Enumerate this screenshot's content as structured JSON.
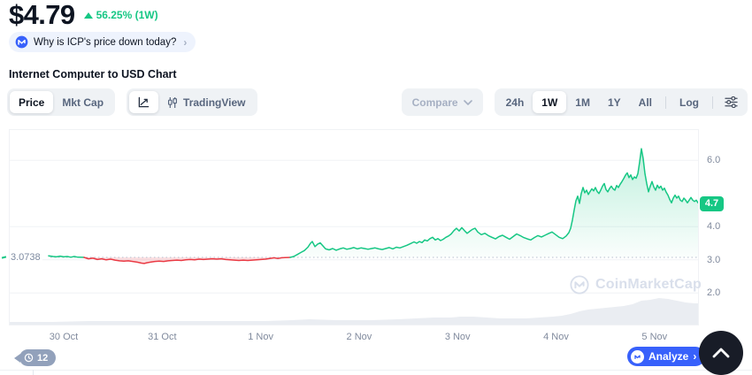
{
  "header": {
    "price": "$4.79",
    "change_direction": "up",
    "change_text": "56.25% (1W)",
    "change_color": "#16c784",
    "question_pill": "Why is ICP's price down today?",
    "chart_title": "Internet Computer to USD Chart"
  },
  "toolbar": {
    "price_label": "Price",
    "mktcap_label": "Mkt Cap",
    "tradingview_label": "TradingView",
    "compare_label": "Compare",
    "ranges": [
      "24h",
      "1W",
      "1M",
      "1Y",
      "All"
    ],
    "active_range": "1W",
    "log_label": "Log"
  },
  "chart": {
    "baseline_label": "3.0738",
    "current_price_label": "4.7",
    "watermark": "CoinMarketCap"
  },
  "footer": {
    "history_count": "12",
    "analyze_label": "Analyze",
    "analyze_chevron": "›"
  },
  "colors": {
    "green": "#16c784",
    "red": "#ea3943",
    "blue": "#3861fb",
    "grey_text": "#808a9d",
    "grid": "#f0f2f5",
    "volume": "#eaedf2",
    "watermark": "#d9dfeb"
  },
  "chart_data": {
    "type": "line",
    "title": "Internet Computer (ICP) to USD, 1W range",
    "y_unit": "USD",
    "x_unit": "px from plot left edge (plot width 780 spans ~30 Oct to ~5 Nov)",
    "x_labels": [
      "30 Oct",
      "31 Oct",
      "1 Nov",
      "2 Nov",
      "3 Nov",
      "4 Nov",
      "5 Nov"
    ],
    "y_axis": {
      "ticks": [
        6.0,
        4.0,
        3.0,
        2.0
      ],
      "range_hint": [
        1.9,
        6.6
      ]
    },
    "baseline": {
      "value": 3.0738,
      "label": "3.0738"
    },
    "current_price": {
      "value": 4.7,
      "label": "4.7"
    },
    "segments": [
      {
        "name": "start-above-baseline",
        "color": "#16c784",
        "fill": "rgba(22,199,132,0.15)",
        "points": [
          [
            45,
            3.12
          ],
          [
            50,
            3.1
          ],
          [
            54,
            3.09
          ],
          [
            58,
            3.11
          ],
          [
            62,
            3.09
          ],
          [
            66,
            3.1
          ],
          [
            70,
            3.08
          ],
          [
            74,
            3.1
          ],
          [
            78,
            3.08
          ],
          [
            82,
            3.076
          ],
          [
            85,
            3.074
          ]
        ]
      },
      {
        "name": "below-baseline",
        "color": "#ea3943",
        "fill": "rgba(234,57,67,0.16)",
        "points": [
          [
            85,
            3.074
          ],
          [
            90,
            3.03
          ],
          [
            95,
            3.05
          ],
          [
            100,
            3.01
          ],
          [
            105,
            3.03
          ],
          [
            110,
            3.0
          ],
          [
            115,
            3.02
          ],
          [
            120,
            2.99
          ],
          [
            125,
            2.97
          ],
          [
            130,
            2.96
          ],
          [
            135,
            2.97
          ],
          [
            140,
            2.95
          ],
          [
            145,
            2.93
          ],
          [
            150,
            2.9
          ],
          [
            153,
            2.89
          ],
          [
            156,
            2.91
          ],
          [
            160,
            2.93
          ],
          [
            165,
            2.95
          ],
          [
            170,
            2.96
          ],
          [
            175,
            2.95
          ],
          [
            180,
            2.97
          ],
          [
            185,
            2.98
          ],
          [
            190,
            2.99
          ],
          [
            195,
            2.98
          ],
          [
            200,
            3.0
          ],
          [
            205,
            3.01
          ],
          [
            210,
            3.0
          ],
          [
            215,
            3.02
          ],
          [
            220,
            3.01
          ],
          [
            225,
            3.02
          ],
          [
            230,
            3.03
          ],
          [
            235,
            3.02
          ],
          [
            240,
            3.03
          ],
          [
            245,
            3.01
          ],
          [
            250,
            3.0
          ],
          [
            255,
            2.99
          ],
          [
            260,
            2.98
          ],
          [
            265,
            2.99
          ],
          [
            270,
            2.98
          ],
          [
            275,
            2.99
          ],
          [
            280,
            3.0
          ],
          [
            285,
            3.01
          ],
          [
            290,
            3.02
          ],
          [
            295,
            3.04
          ],
          [
            300,
            3.06
          ],
          [
            304,
            3.04
          ],
          [
            308,
            3.06
          ],
          [
            312,
            3.065
          ],
          [
            316,
            3.07
          ],
          [
            318,
            3.074
          ]
        ]
      },
      {
        "name": "rally-above-baseline",
        "color": "#16c784",
        "fill": "gradient-green",
        "points": [
          [
            318,
            3.074
          ],
          [
            322,
            3.1
          ],
          [
            326,
            3.16
          ],
          [
            330,
            3.22
          ],
          [
            334,
            3.28
          ],
          [
            338,
            3.38
          ],
          [
            341,
            3.5
          ],
          [
            343,
            3.55
          ],
          [
            346,
            3.4
          ],
          [
            349,
            3.47
          ],
          [
            352,
            3.51
          ],
          [
            355,
            3.42
          ],
          [
            358,
            3.33
          ],
          [
            362,
            3.3
          ],
          [
            366,
            3.34
          ],
          [
            370,
            3.29
          ],
          [
            374,
            3.33
          ],
          [
            378,
            3.36
          ],
          [
            382,
            3.32
          ],
          [
            386,
            3.34
          ],
          [
            390,
            3.37
          ],
          [
            394,
            3.33
          ],
          [
            398,
            3.36
          ],
          [
            402,
            3.34
          ],
          [
            406,
            3.32
          ],
          [
            410,
            3.34
          ],
          [
            414,
            3.36
          ],
          [
            418,
            3.33
          ],
          [
            422,
            3.31
          ],
          [
            426,
            3.34
          ],
          [
            430,
            3.37
          ],
          [
            434,
            3.33
          ],
          [
            438,
            3.38
          ],
          [
            442,
            3.36
          ],
          [
            446,
            3.4
          ],
          [
            450,
            3.44
          ],
          [
            454,
            3.49
          ],
          [
            458,
            3.54
          ],
          [
            461,
            3.5
          ],
          [
            464,
            3.55
          ],
          [
            467,
            3.52
          ],
          [
            470,
            3.6
          ],
          [
            473,
            3.57
          ],
          [
            476,
            3.64
          ],
          [
            479,
            3.68
          ],
          [
            482,
            3.6
          ],
          [
            485,
            3.64
          ],
          [
            488,
            3.58
          ],
          [
            491,
            3.62
          ],
          [
            494,
            3.68
          ],
          [
            497,
            3.72
          ],
          [
            500,
            3.78
          ],
          [
            503,
            3.88
          ],
          [
            506,
            3.95
          ],
          [
            509,
            3.87
          ],
          [
            512,
            3.97
          ],
          [
            515,
            3.88
          ],
          [
            518,
            3.8
          ],
          [
            521,
            3.86
          ],
          [
            524,
            3.92
          ],
          [
            527,
            3.95
          ],
          [
            530,
            3.84
          ],
          [
            534,
            3.76
          ],
          [
            538,
            3.8
          ],
          [
            542,
            3.73
          ],
          [
            546,
            3.68
          ],
          [
            550,
            3.63
          ],
          [
            554,
            3.7
          ],
          [
            558,
            3.74
          ],
          [
            562,
            3.68
          ],
          [
            566,
            3.62
          ],
          [
            570,
            3.7
          ],
          [
            574,
            3.78
          ],
          [
            578,
            3.73
          ],
          [
            582,
            3.67
          ],
          [
            586,
            3.63
          ],
          [
            590,
            3.6
          ],
          [
            594,
            3.67
          ],
          [
            598,
            3.73
          ],
          [
            602,
            3.69
          ],
          [
            606,
            3.74
          ],
          [
            610,
            3.79
          ],
          [
            614,
            3.84
          ],
          [
            618,
            3.76
          ],
          [
            622,
            3.68
          ],
          [
            626,
            3.64
          ],
          [
            630,
            3.72
          ],
          [
            633,
            3.82
          ],
          [
            635,
            3.95
          ],
          [
            637,
            4.2
          ],
          [
            639,
            4.5
          ],
          [
            641,
            4.78
          ],
          [
            643,
            4.92
          ],
          [
            645,
            4.7
          ],
          [
            647,
            5.0
          ],
          [
            649,
            5.18
          ],
          [
            651,
            5.02
          ],
          [
            653,
            5.1
          ],
          [
            655,
            4.97
          ],
          [
            657,
            5.06
          ],
          [
            659,
            5.14
          ],
          [
            661,
            5.08
          ],
          [
            663,
            5.18
          ],
          [
            665,
            5.06
          ],
          [
            667,
            5.0
          ],
          [
            669,
            5.1
          ],
          [
            671,
            5.22
          ],
          [
            673,
            5.3
          ],
          [
            675,
            5.12
          ],
          [
            677,
            5.05
          ],
          [
            679,
            5.15
          ],
          [
            681,
            5.22
          ],
          [
            683,
            5.14
          ],
          [
            685,
            5.1
          ],
          [
            687,
            5.24
          ],
          [
            689,
            5.18
          ],
          [
            691,
            5.28
          ],
          [
            693,
            5.36
          ],
          [
            695,
            5.45
          ],
          [
            697,
            5.55
          ],
          [
            699,
            5.62
          ],
          [
            701,
            5.48
          ],
          [
            703,
            5.56
          ],
          [
            705,
            5.42
          ],
          [
            707,
            5.5
          ],
          [
            709,
            5.46
          ],
          [
            711,
            5.6
          ],
          [
            713,
            5.95
          ],
          [
            715,
            6.35
          ],
          [
            717,
            6.05
          ],
          [
            719,
            5.6
          ],
          [
            721,
            5.3
          ],
          [
            723,
            5.05
          ],
          [
            725,
            5.22
          ],
          [
            727,
            5.36
          ],
          [
            729,
            5.2
          ],
          [
            731,
            5.1
          ],
          [
            733,
            5.25
          ],
          [
            735,
            5.16
          ],
          [
            737,
            5.22
          ],
          [
            739,
            5.1
          ],
          [
            741,
            5.16
          ],
          [
            743,
            5.04
          ],
          [
            745,
            4.95
          ],
          [
            747,
            4.82
          ],
          [
            749,
            4.72
          ],
          [
            751,
            4.86
          ],
          [
            753,
            4.95
          ],
          [
            755,
            4.86
          ],
          [
            757,
            4.92
          ],
          [
            759,
            4.8
          ],
          [
            761,
            4.76
          ],
          [
            763,
            4.86
          ],
          [
            765,
            4.8
          ],
          [
            767,
            4.72
          ],
          [
            769,
            4.8
          ],
          [
            771,
            4.88
          ],
          [
            773,
            4.8
          ],
          [
            775,
            4.76
          ],
          [
            777,
            4.8
          ],
          [
            779,
            4.72
          ],
          [
            780,
            4.7
          ]
        ]
      }
    ],
    "volume_silhouette": {
      "comment": "x px, bar height px above plot bottom",
      "points": [
        [
          0,
          2
        ],
        [
          50,
          2
        ],
        [
          90,
          3
        ],
        [
          140,
          3
        ],
        [
          190,
          3
        ],
        [
          240,
          3
        ],
        [
          290,
          3
        ],
        [
          320,
          4
        ],
        [
          340,
          5
        ],
        [
          370,
          4
        ],
        [
          410,
          4
        ],
        [
          440,
          5
        ],
        [
          460,
          6
        ],
        [
          480,
          7
        ],
        [
          500,
          7
        ],
        [
          510,
          8
        ],
        [
          525,
          8
        ],
        [
          540,
          7
        ],
        [
          555,
          6
        ],
        [
          570,
          6
        ],
        [
          585,
          6
        ],
        [
          600,
          7
        ],
        [
          615,
          8
        ],
        [
          625,
          9
        ],
        [
          635,
          11
        ],
        [
          645,
          14
        ],
        [
          655,
          16
        ],
        [
          665,
          17
        ],
        [
          675,
          18
        ],
        [
          685,
          19
        ],
        [
          695,
          20
        ],
        [
          705,
          22
        ],
        [
          715,
          26
        ],
        [
          725,
          27
        ],
        [
          735,
          29
        ],
        [
          745,
          28
        ],
        [
          755,
          26
        ],
        [
          765,
          24
        ],
        [
          775,
          23
        ],
        [
          780,
          23
        ]
      ]
    }
  }
}
